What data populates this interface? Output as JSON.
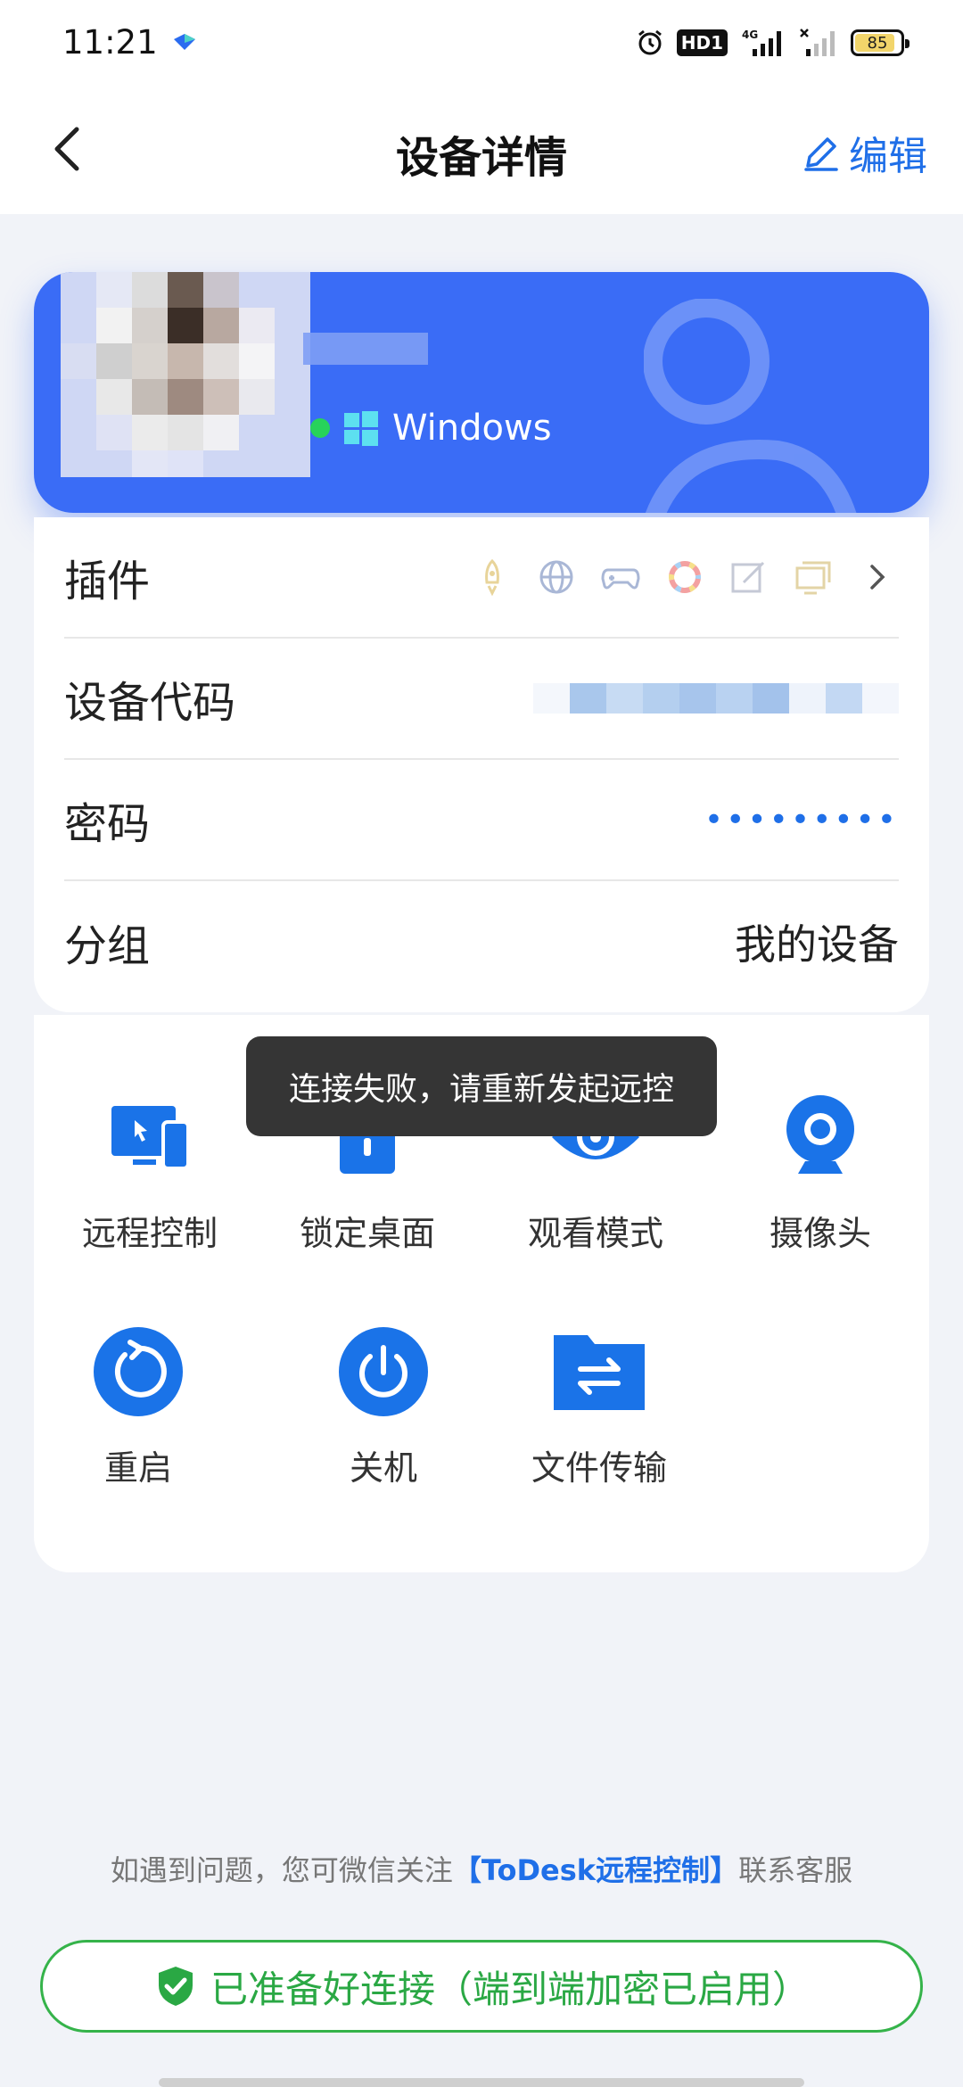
{
  "status_bar": {
    "time": "11:21",
    "hd_label": "HD1",
    "network": "4G",
    "battery": "85"
  },
  "header": {
    "title": "设备详情",
    "edit_label": "编辑"
  },
  "device": {
    "os": "Windows",
    "online": true
  },
  "info": {
    "plugins_label": "插件",
    "plugin_icons": [
      "rocket-icon",
      "globe-icon",
      "gamepad-icon",
      "color-wheel-icon",
      "pen-tablet-icon",
      "screens-icon"
    ],
    "device_code_label": "设备代码",
    "password_label": "密码",
    "password_value": "•••••••••",
    "group_label": "分组",
    "group_value": "我的设备"
  },
  "actions": {
    "remote_control": "远程控制",
    "lock_desktop": "锁定桌面",
    "watch_mode": "观看模式",
    "camera": "摄像头",
    "restart": "重启",
    "shutdown": "关机",
    "file_transfer": "文件传输"
  },
  "toast": "连接失败，请重新发起远控",
  "help": {
    "prefix": "如遇到问题，您可微信关注",
    "brand": "【ToDesk远程控制】",
    "suffix": "联系客服"
  },
  "ready_status": "已准备好连接（端到端加密已启用）",
  "colors": {
    "accent": "#1f6fe8",
    "card": "#3a6cf6",
    "success": "#2aa844"
  }
}
